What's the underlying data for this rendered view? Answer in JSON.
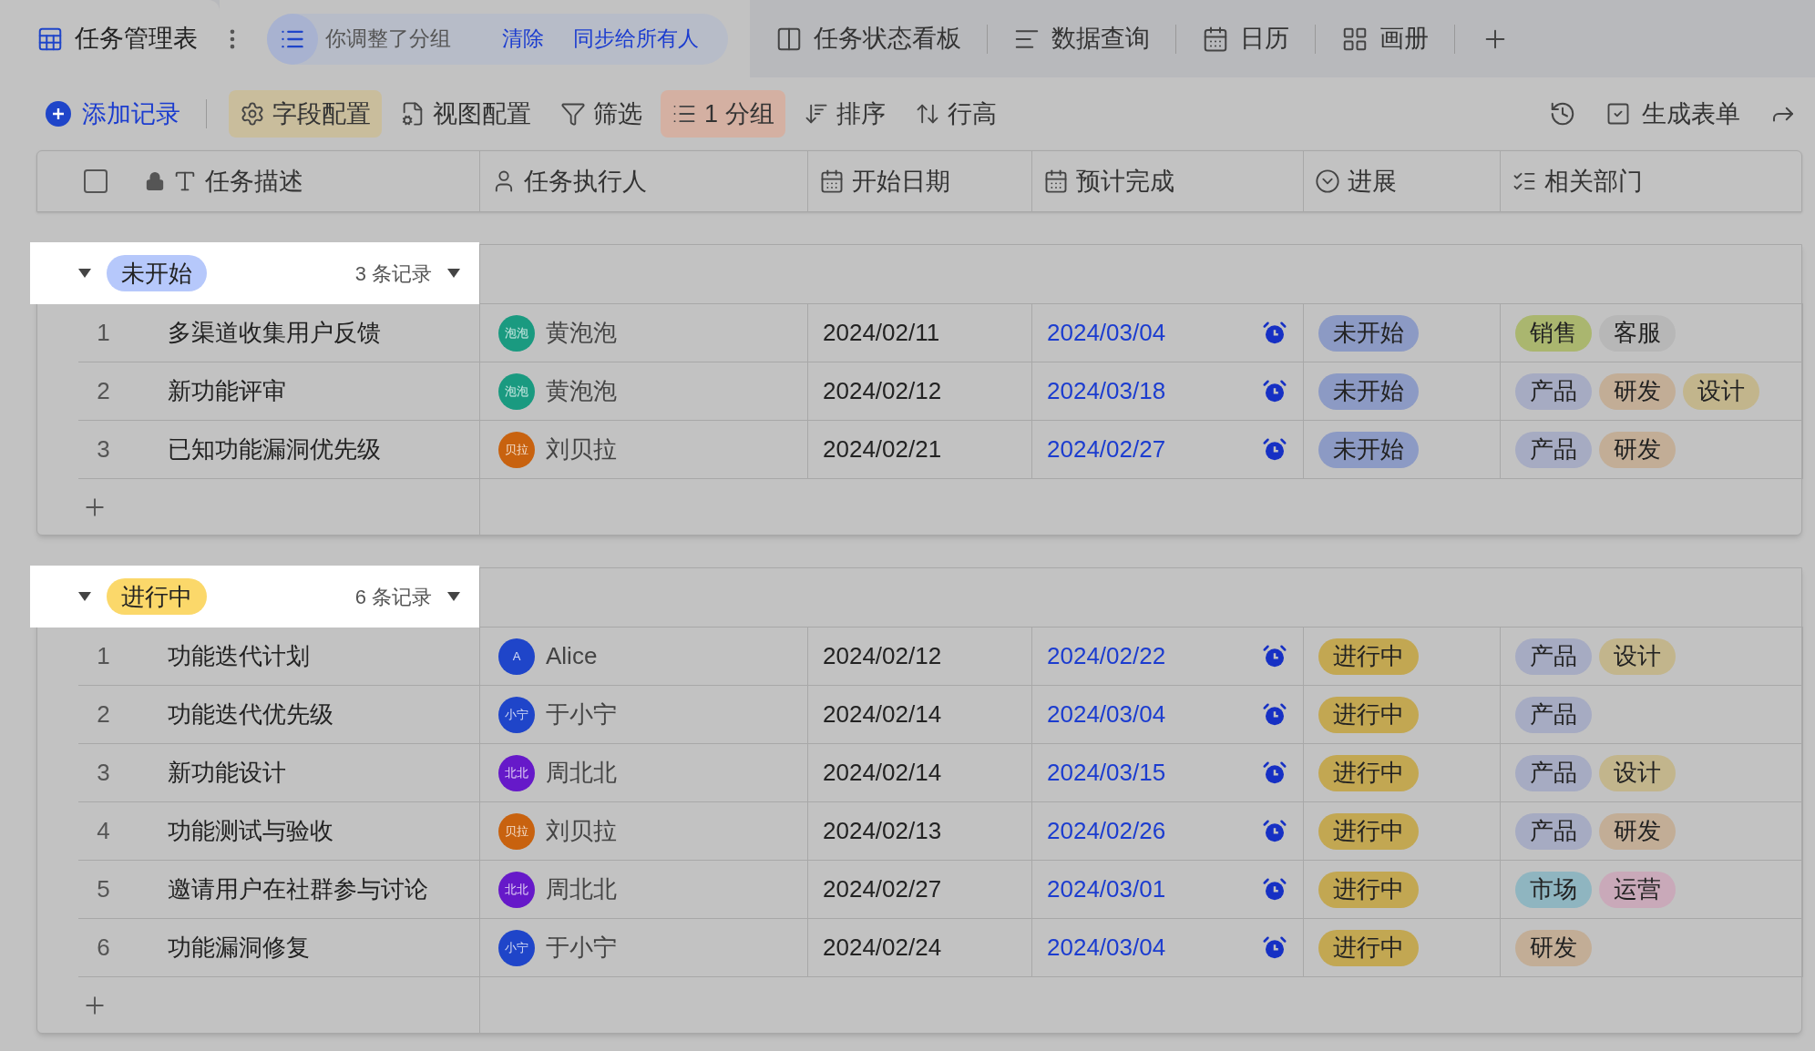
{
  "tabs": [
    {
      "label": "任务管理表",
      "kind": "table",
      "selected": true
    },
    {
      "label": "任务状态看板",
      "kind": "kanban",
      "selected": false
    },
    {
      "label": "数据查询",
      "kind": "query",
      "selected": false
    },
    {
      "label": "日历",
      "kind": "calendar",
      "selected": false
    },
    {
      "label": "画册",
      "kind": "gallery",
      "selected": false
    }
  ],
  "notice": {
    "text": "你调整了分组",
    "actions": [
      "清除",
      "同步给所有人"
    ]
  },
  "toolbar": [
    {
      "label": "添加记录",
      "kind": "add"
    },
    {
      "label": "字段配置",
      "kind": "fields",
      "color": "#c9bd9c"
    },
    {
      "label": "视图配置",
      "kind": "view"
    },
    {
      "label": "筛选",
      "kind": "filter"
    },
    {
      "label": "1 分组",
      "kind": "group",
      "color": "#d4b0a2"
    },
    {
      "label": "排序",
      "kind": "sort"
    },
    {
      "label": "行高",
      "kind": "height"
    }
  ],
  "toolbar_right": [
    {
      "kind": "history"
    },
    {
      "label": "生成表单",
      "kind": "form"
    },
    {
      "kind": "share"
    }
  ],
  "select_all": {
    "checked": false
  },
  "columns": [
    {
      "label": "任务描述",
      "kind": "text"
    },
    {
      "label": "任务执行人",
      "kind": "person"
    },
    {
      "label": "开始日期",
      "kind": "date"
    },
    {
      "label": "预计完成",
      "kind": "date"
    },
    {
      "label": "进展",
      "kind": "status"
    },
    {
      "label": "相关部门",
      "kind": "multi"
    }
  ],
  "groups": [
    {
      "label": "未开始",
      "color": "#b6c8fb",
      "count": "3 条记录",
      "expanded": true,
      "rows": [
        {
          "index": "1",
          "task": "多渠道收集用户反馈",
          "assignee": {
            "initials": "泡泡",
            "name": "黄泡泡",
            "color": "#1a9a80"
          },
          "start": "2024/02/11",
          "due": "2024/03/04",
          "status": {
            "label": "未开始",
            "color": "#8c9ac4"
          },
          "departments": [
            {
              "label": "销售",
              "color": "#aab66f"
            },
            {
              "label": "客服",
              "color": "#b7b7b7"
            }
          ]
        },
        {
          "index": "2",
          "task": "新功能评审",
          "assignee": {
            "initials": "泡泡",
            "name": "黄泡泡",
            "color": "#1a9a80"
          },
          "start": "2024/02/12",
          "due": "2024/03/18",
          "status": {
            "label": "未开始",
            "color": "#8c9ac4"
          },
          "departments": [
            {
              "label": "产品",
              "color": "#a6abc2"
            },
            {
              "label": "研发",
              "color": "#c2ad96"
            },
            {
              "label": "设计",
              "color": "#c2b58c"
            }
          ]
        },
        {
          "index": "3",
          "task": "已知功能漏洞优先级",
          "assignee": {
            "initials": "贝拉",
            "name": "刘贝拉",
            "color": "#c8620f"
          },
          "start": "2024/02/21",
          "due": "2024/02/27",
          "status": {
            "label": "未开始",
            "color": "#8c9ac4"
          },
          "departments": [
            {
              "label": "产品",
              "color": "#a6abc2"
            },
            {
              "label": "研发",
              "color": "#c2ad96"
            }
          ]
        }
      ]
    },
    {
      "label": "进行中",
      "color": "#fbd86a",
      "count": "6 条记录",
      "expanded": true,
      "rows": [
        {
          "index": "1",
          "task": "功能迭代计划",
          "assignee": {
            "initials": "A",
            "name": "Alice",
            "color": "#1f45c9"
          },
          "start": "2024/02/12",
          "due": "2024/02/22",
          "status": {
            "label": "进行中",
            "color": "#c2a752"
          },
          "departments": [
            {
              "label": "产品",
              "color": "#a6abc2"
            },
            {
              "label": "设计",
              "color": "#c2b58c"
            }
          ]
        },
        {
          "index": "2",
          "task": "功能迭代优先级",
          "assignee": {
            "initials": "小宁",
            "name": "于小宁",
            "color": "#1f45c9"
          },
          "start": "2024/02/14",
          "due": "2024/03/04",
          "status": {
            "label": "进行中",
            "color": "#c2a752"
          },
          "departments": [
            {
              "label": "产品",
              "color": "#a6abc2"
            }
          ]
        },
        {
          "index": "3",
          "task": "新功能设计",
          "assignee": {
            "initials": "北北",
            "name": "周北北",
            "color": "#6619c9"
          },
          "start": "2024/02/14",
          "due": "2024/03/15",
          "status": {
            "label": "进行中",
            "color": "#c2a752"
          },
          "departments": [
            {
              "label": "产品",
              "color": "#a6abc2"
            },
            {
              "label": "设计",
              "color": "#c2b58c"
            }
          ]
        },
        {
          "index": "4",
          "task": "功能测试与验收",
          "assignee": {
            "initials": "贝拉",
            "name": "刘贝拉",
            "color": "#c8620f"
          },
          "start": "2024/02/13",
          "due": "2024/02/26",
          "status": {
            "label": "进行中",
            "color": "#c2a752"
          },
          "departments": [
            {
              "label": "产品",
              "color": "#a6abc2"
            },
            {
              "label": "研发",
              "color": "#c2ad96"
            }
          ]
        },
        {
          "index": "5",
          "task": "邀请用户在社群参与讨论",
          "assignee": {
            "initials": "北北",
            "name": "周北北",
            "color": "#6619c9"
          },
          "start": "2024/02/27",
          "due": "2024/03/01",
          "status": {
            "label": "进行中",
            "color": "#c2a752"
          },
          "departments": [
            {
              "label": "市场",
              "color": "#8fb5c0"
            },
            {
              "label": "运营",
              "color": "#c9a9b9"
            }
          ]
        },
        {
          "index": "6",
          "task": "功能漏洞修复",
          "assignee": {
            "initials": "小宁",
            "name": "于小宁",
            "color": "#1f45c9"
          },
          "start": "2024/02/24",
          "due": "2024/03/04",
          "status": {
            "label": "进行中",
            "color": "#c2a752"
          },
          "departments": [
            {
              "label": "研发",
              "color": "#c2ad96"
            }
          ]
        }
      ]
    }
  ]
}
